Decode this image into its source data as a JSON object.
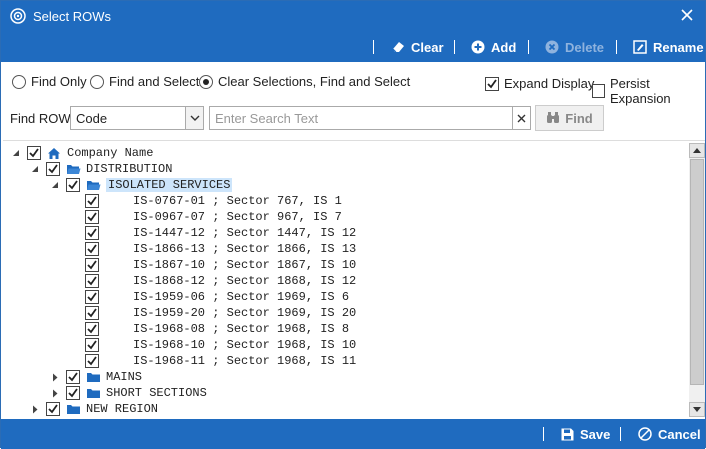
{
  "window": {
    "title": "Select ROWs"
  },
  "toolbar": {
    "clear": "Clear",
    "add": "Add",
    "delete": "Delete",
    "rename": "Rename"
  },
  "options": {
    "find_only": "Find Only",
    "find_and_select": "Find and Select",
    "clear_find_select": "Clear Selections, Find and Select",
    "selected_mode": "clear_find_select",
    "expand_display": {
      "label": "Expand Display",
      "checked": true
    },
    "persist_expansion": {
      "label": "Persist Expansion",
      "checked": false
    }
  },
  "find": {
    "label": "Find ROW",
    "field_value": "Code",
    "search_placeholder": "Enter Search Text",
    "search_value": "",
    "button": "Find"
  },
  "tree": {
    "root": "Company Name",
    "distribution": "DISTRIBUTION",
    "isolated": "ISOLATED SERVICES",
    "items": [
      "IS-0767-01 ; Sector 767, IS 1",
      "IS-0967-07 ; Sector 967, IS 7",
      "IS-1447-12 ; Sector 1447, IS 12",
      "IS-1866-13 ; Sector 1866, IS 13",
      "IS-1867-10 ; Sector 1867, IS 10",
      "IS-1868-12 ; Sector 1868, IS 12",
      "IS-1959-06 ; Sector 1969, IS 6",
      "IS-1959-20 ; Sector 1969, IS 20",
      "IS-1968-08 ; Sector 1968, IS 8",
      "IS-1968-10 ; Sector 1968, IS 10",
      "IS-1968-11 ; Sector 1968, IS 11"
    ],
    "mains": "MAINS",
    "short_sections": "SHORT SECTIONS",
    "new_region": "NEW REGION"
  },
  "footer": {
    "save": "Save",
    "cancel": "Cancel"
  },
  "colors": {
    "accent": "#1f6bbf",
    "folder": "#1f6bbf",
    "selection": "#cde5fb"
  }
}
